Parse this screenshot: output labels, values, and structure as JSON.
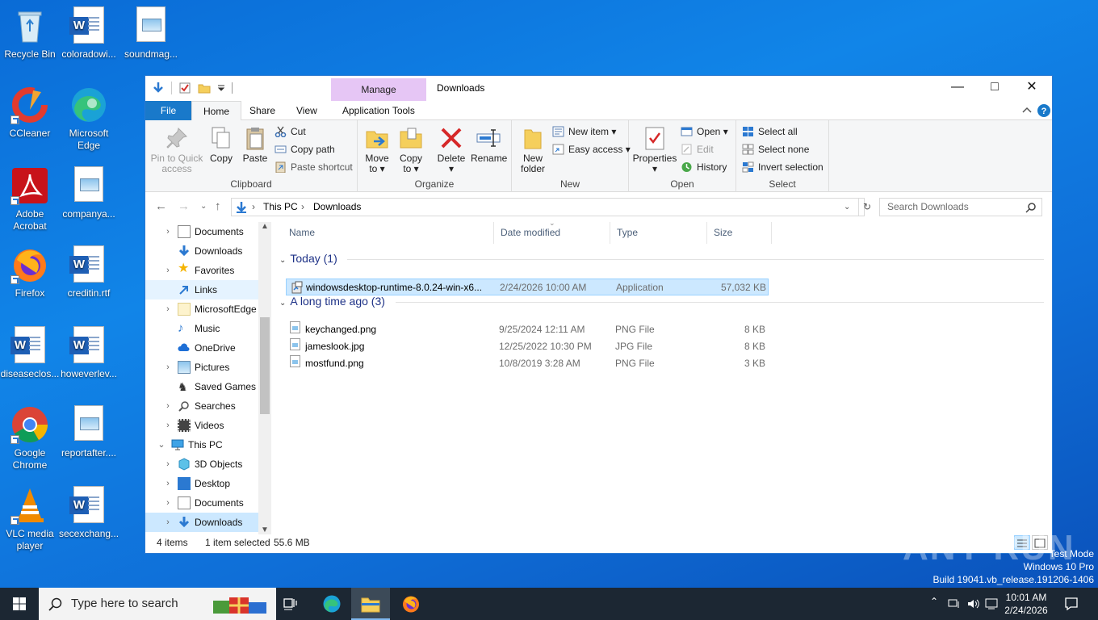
{
  "desktop": {
    "icons": [
      {
        "label": "Recycle Bin"
      },
      {
        "label": "coloradowi..."
      },
      {
        "label": "soundmag..."
      },
      {
        "label": "CCleaner"
      },
      {
        "label": "Microsoft Edge"
      },
      {
        "label": "Adobe Acrobat"
      },
      {
        "label": "companya..."
      },
      {
        "label": "Firefox"
      },
      {
        "label": "creditin.rtf"
      },
      {
        "label": "diseaseclos..."
      },
      {
        "label": "howeverlev..."
      },
      {
        "label": "Google Chrome"
      },
      {
        "label": "reportafter...."
      },
      {
        "label": "VLC media player"
      },
      {
        "label": "secexchang..."
      }
    ]
  },
  "window": {
    "title": "Downloads",
    "manage_tab": "Manage",
    "tabs": [
      "File",
      "Home",
      "Share",
      "View",
      "Application Tools"
    ],
    "ribbon": {
      "clipboard": {
        "label": "Clipboard",
        "pin": "Pin to Quick access",
        "copy": "Copy",
        "paste": "Paste",
        "cut": "Cut",
        "copy_path": "Copy path",
        "paste_shortcut": "Paste shortcut"
      },
      "organize": {
        "label": "Organize",
        "move_to": "Move to",
        "copy_to": "Copy to",
        "delete": "Delete",
        "rename": "Rename"
      },
      "new": {
        "label": "New",
        "new_folder": "New folder",
        "new_item": "New item",
        "easy_access": "Easy access"
      },
      "open": {
        "label": "Open",
        "properties": "Properties",
        "open": "Open",
        "edit": "Edit",
        "history": "History"
      },
      "select": {
        "label": "Select",
        "select_all": "Select all",
        "select_none": "Select none",
        "invert": "Invert selection"
      }
    },
    "address": {
      "crumbs": [
        "This PC",
        "Downloads"
      ],
      "search_placeholder": "Search Downloads"
    },
    "nav": [
      {
        "label": "Documents"
      },
      {
        "label": "Downloads"
      },
      {
        "label": "Favorites"
      },
      {
        "label": "Links"
      },
      {
        "label": "MicrosoftEdge"
      },
      {
        "label": "Music"
      },
      {
        "label": "OneDrive"
      },
      {
        "label": "Pictures"
      },
      {
        "label": "Saved Games"
      },
      {
        "label": "Searches"
      },
      {
        "label": "Videos"
      },
      {
        "label": "This PC"
      },
      {
        "label": "3D Objects"
      },
      {
        "label": "Desktop"
      },
      {
        "label": "Documents"
      },
      {
        "label": "Downloads"
      }
    ],
    "columns": [
      "Name",
      "Date modified",
      "Type",
      "Size"
    ],
    "groups": [
      {
        "title": "Today (1)",
        "files": [
          {
            "name": "windowsdesktop-runtime-8.0.24-win-x6...",
            "date": "2/24/2026 10:00 AM",
            "type": "Application",
            "size": "57,032 KB"
          }
        ]
      },
      {
        "title": "A long time ago (3)",
        "files": [
          {
            "name": "keychanged.png",
            "date": "9/25/2024 12:11 AM",
            "type": "PNG File",
            "size": "8 KB"
          },
          {
            "name": "jameslook.jpg",
            "date": "12/25/2022 10:30 PM",
            "type": "JPG File",
            "size": "8 KB"
          },
          {
            "name": "mostfund.png",
            "date": "10/8/2019 3:28 AM",
            "type": "PNG File",
            "size": "3 KB"
          }
        ]
      }
    ],
    "status": {
      "items": "4 items",
      "selected": "1 item selected",
      "size": "55.6 MB"
    }
  },
  "taskbar": {
    "search_placeholder": "Type here to search",
    "time": "10:01 AM",
    "date": "2/24/2026"
  },
  "watermark": {
    "line1": "Test Mode",
    "line2": "Windows 10 Pro",
    "line3": "Build 19041.vb_release.191206-1406",
    "brand": "ANY RUN"
  },
  "colors": {
    "accent": "#1979ca",
    "selection": "#cce8ff",
    "manage": "#e6c6f5"
  }
}
